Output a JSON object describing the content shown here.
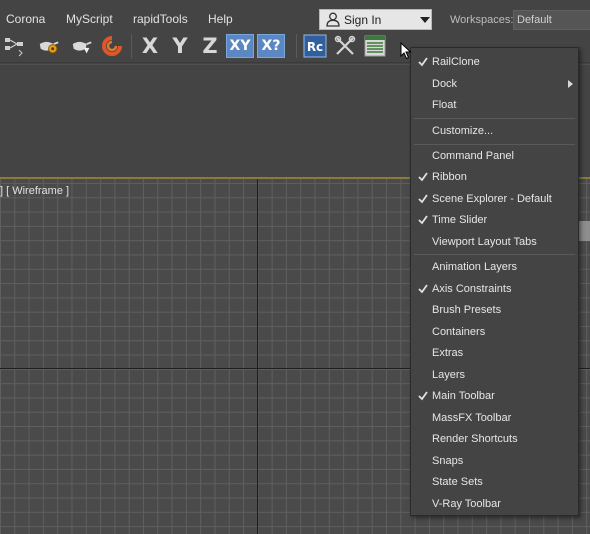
{
  "menubar": {
    "items": [
      "Corona",
      "MyScript",
      "rapidTools",
      "Help"
    ],
    "signin_label": "Sign In",
    "workspaces_label": "Workspaces:",
    "workspace_value": "Default"
  },
  "toolbar": {
    "icons": [
      "schematic-view-icon",
      "render-setup-icon",
      "render-frame-icon",
      "corona-render-icon"
    ],
    "axis_x": "X",
    "axis_y": "Y",
    "axis_z": "Z",
    "plane_xy": "XY",
    "plane_toggle": "X?",
    "railclone_icon": "Rc",
    "tools_icons": [
      "scissors-tools-icon",
      "list-table-icon"
    ]
  },
  "viewport": {
    "label": "] [ Wireframe ]"
  },
  "context_menu": {
    "items": [
      {
        "label": "RailClone",
        "checked": true
      },
      {
        "label": "Dock",
        "checked": false,
        "submenu": true
      },
      {
        "label": "Float",
        "checked": false
      },
      {
        "label": "Customize...",
        "checked": false
      },
      {
        "label": "Command Panel",
        "checked": false
      },
      {
        "label": "Ribbon",
        "checked": true
      },
      {
        "label": "Scene Explorer - Default",
        "checked": true
      },
      {
        "label": "Time Slider",
        "checked": true
      },
      {
        "label": "Viewport Layout Tabs",
        "checked": false
      },
      {
        "label": "Animation Layers",
        "checked": false
      },
      {
        "label": "Axis Constraints",
        "checked": true
      },
      {
        "label": "Brush Presets",
        "checked": false
      },
      {
        "label": "Containers",
        "checked": false
      },
      {
        "label": "Extras",
        "checked": false
      },
      {
        "label": "Layers",
        "checked": false
      },
      {
        "label": "Main Toolbar",
        "checked": true
      },
      {
        "label": "MassFX Toolbar",
        "checked": false
      },
      {
        "label": "Render Shortcuts",
        "checked": false
      },
      {
        "label": "Snaps",
        "checked": false
      },
      {
        "label": "State Sets",
        "checked": false
      },
      {
        "label": "V-Ray Toolbar",
        "checked": false
      }
    ]
  },
  "colors": {
    "background": "#444444",
    "toggle_active": "#5b88c2",
    "ribbon_accent": "#8a7a3c"
  }
}
